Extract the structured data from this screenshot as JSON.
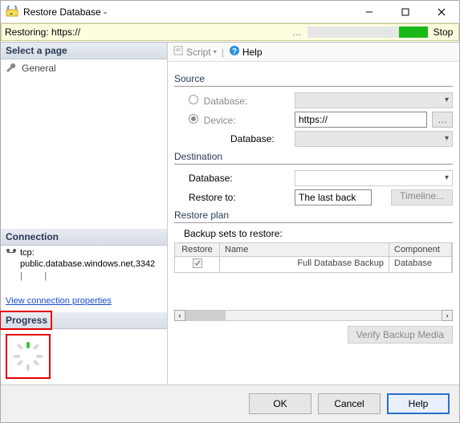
{
  "window": {
    "title": "Restore Database -"
  },
  "info": {
    "restoring": "Restoring: https://",
    "stop": "Stop"
  },
  "left": {
    "select_page": "Select a page",
    "general": "General",
    "connection": "Connection",
    "conn_line1": "tcp:",
    "conn_line2": "public.database.windows.net,3342",
    "view_props": "View connection properties",
    "progress": "Progress"
  },
  "toolbar": {
    "script": "Script",
    "help": "Help"
  },
  "content": {
    "source": "Source",
    "database_label": "Database:",
    "device_label": "Device:",
    "device_value": "https://",
    "database_sub_label": "Database:",
    "destination": "Destination",
    "dest_database": "Database:",
    "restore_to": "Restore to:",
    "restore_to_value": "The last back",
    "timeline": "Timeline...",
    "restore_plan": "Restore plan",
    "backup_sets": "Backup sets to restore:",
    "col_restore": "Restore",
    "col_name": "Name",
    "col_component": "Component",
    "row_name": "Full Database Backup",
    "row_component": "Database",
    "verify": "Verify Backup Media"
  },
  "footer": {
    "ok": "OK",
    "cancel": "Cancel",
    "help": "Help"
  }
}
